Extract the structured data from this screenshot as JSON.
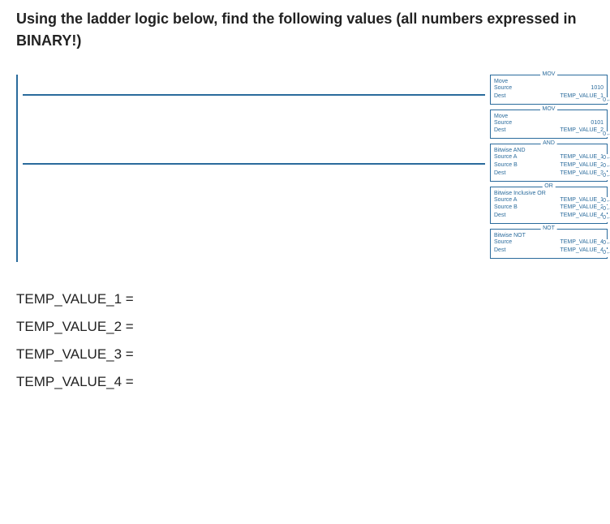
{
  "question": "Using the ladder logic below, find the following values (all numbers expressed in BINARY!)",
  "rung1": {
    "inst1": {
      "title": "MOV",
      "sub": "Move",
      "rows": [
        {
          "lbl": "Source",
          "val": "1010"
        },
        {
          "lbl": "Dest",
          "val": "TEMP_VALUE_1"
        }
      ],
      "corner": "0←"
    },
    "inst2": {
      "title": "MOV",
      "sub": "Move",
      "rows": [
        {
          "lbl": "Source",
          "val": "0101"
        },
        {
          "lbl": "Dest",
          "val": "TEMP_VALUE_2"
        }
      ],
      "corner": "0←"
    }
  },
  "rung2": {
    "inst1": {
      "title": "AND",
      "sub": "Bitwise AND",
      "rows": [
        {
          "lbl": "Source A",
          "val": "TEMP_VALUE_1",
          "corner": "0←"
        },
        {
          "lbl": "Source B",
          "val": "TEMP_VALUE_2",
          "corner": "0←"
        },
        {
          "lbl": "Dest",
          "val": "TEMP_VALUE_3",
          "corner": "0←"
        }
      ]
    },
    "inst2": {
      "title": "OR",
      "sub": "Bitwise Inclusive OR",
      "rows": [
        {
          "lbl": "Source A",
          "val": "TEMP_VALUE_1",
          "corner": "0←"
        },
        {
          "lbl": "Source B",
          "val": "TEMP_VALUE_2",
          "corner": "0←"
        },
        {
          "lbl": "Dest",
          "val": "TEMP_VALUE_4",
          "corner": "0←"
        }
      ]
    },
    "inst3": {
      "title": "NOT",
      "sub": "Bitwise NOT",
      "rows": [
        {
          "lbl": "Source",
          "val": "TEMP_VALUE_4",
          "corner": "0←"
        },
        {
          "lbl": "Dest",
          "val": "TEMP_VALUE_4",
          "corner": "0←"
        }
      ]
    }
  },
  "answers": {
    "a1": "TEMP_VALUE_1 =",
    "a2": "TEMP_VALUE_2 =",
    "a3": "TEMP_VALUE_3 =",
    "a4": "TEMP_VALUE_4 ="
  }
}
